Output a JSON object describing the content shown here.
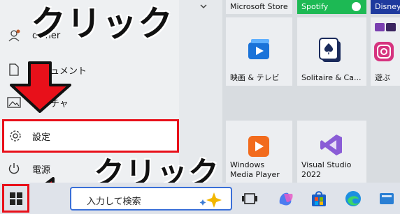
{
  "annotations": {
    "top": "クリック",
    "bottom": "クリック"
  },
  "start_menu": {
    "user": {
      "name": "owner"
    },
    "items": [
      {
        "label": "ドキュメント"
      },
      {
        "label": "ピクチャ"
      },
      {
        "label": "設定"
      },
      {
        "label": "電源"
      }
    ]
  },
  "tiles": {
    "top_row": [
      "Microsoft Store",
      "Spotify",
      "Disney"
    ],
    "apps": [
      {
        "label": "映画 & テレビ"
      },
      {
        "label": "Solitaire & Ca..."
      },
      {
        "label": "遊ぶ"
      },
      {
        "label_line1": "Windows",
        "label_line2": "Media Player"
      },
      {
        "label_line1": "Visual Studio",
        "label_line2": "2022"
      }
    ]
  },
  "taskbar": {
    "search_text": "入力して検索",
    "icons": [
      "task-view-icon",
      "copilot-icon",
      "store-icon",
      "edge-icon",
      "taskbar-app-icon"
    ]
  },
  "colors": {
    "highlight_red": "#e8101a",
    "spotify_green": "#1db954",
    "disney_blue": "#1e3a9e",
    "accent": "#0067c0"
  }
}
